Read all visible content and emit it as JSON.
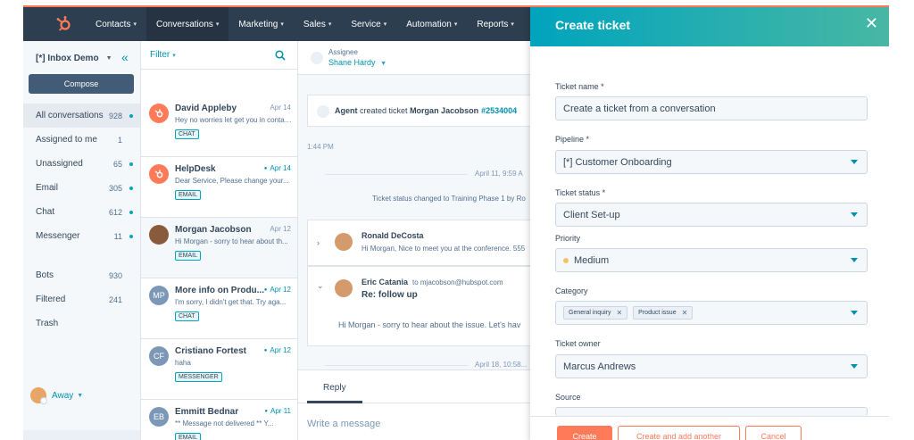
{
  "nav": {
    "items": [
      {
        "label": "Contacts"
      },
      {
        "label": "Conversations"
      },
      {
        "label": "Marketing"
      },
      {
        "label": "Sales"
      },
      {
        "label": "Service"
      },
      {
        "label": "Automation"
      },
      {
        "label": "Reports"
      }
    ]
  },
  "sidebar": {
    "inbox_name": "[*] Inbox Demo",
    "compose_label": "Compose",
    "items": [
      {
        "label": "All conversations",
        "count": "928"
      },
      {
        "label": "Assigned to me",
        "count": "1"
      },
      {
        "label": "Unassigned",
        "count": "65"
      },
      {
        "label": "Email",
        "count": "305"
      },
      {
        "label": "Chat",
        "count": "612"
      },
      {
        "label": "Messenger",
        "count": "11"
      },
      {
        "label": "Bots",
        "count": "930"
      },
      {
        "label": "Filtered",
        "count": "241"
      },
      {
        "label": "Trash",
        "count": ""
      }
    ],
    "status": "Away"
  },
  "list": {
    "filter_label": "Filter",
    "conversations": [
      {
        "name": "David Appleby",
        "date": "Apr 14",
        "preview": "Hey no worries let get you in contact...",
        "tag": "CHAT",
        "avatar": "HS"
      },
      {
        "name": "HelpDesk",
        "date": "Apr 14",
        "preview": "Dear Service, Please change your...",
        "tag": "EMAIL",
        "avatar": "HS"
      },
      {
        "name": "Morgan Jacobson",
        "date": "Apr 12",
        "preview": "Hi Morgan - sorry to hear about th...",
        "tag": "EMAIL",
        "avatar": ""
      },
      {
        "name": "More info on Produ...",
        "date": "Apr 12",
        "preview": "I'm sorry, I didn't get that. Try aga...",
        "tag": "CHAT",
        "avatar": "MP"
      },
      {
        "name": "Cristiano Fortest",
        "date": "Apr 12",
        "preview": "haha",
        "tag": "MESSENGER",
        "avatar": "CF"
      },
      {
        "name": "Emmitt Bednar",
        "date": "Apr 11",
        "preview": "** Message not delivered ** Y...",
        "tag": "EMAIL",
        "avatar": "EB"
      }
    ]
  },
  "thread": {
    "assignee_label": "Assignee",
    "assignee_name": "Shane Hardy",
    "event_agent": "Agent",
    "event_text": "created ticket",
    "event_contact": "Morgan Jacobson",
    "event_ticket": "#2534004",
    "event_time": "1:44 PM",
    "date_sep_1": "April 11, 9:59 A",
    "status_change": "Ticket status changed to Training Phase 1 by Ro",
    "msg1_name": "Ronald DeCosta",
    "msg1_preview": "Hi Morgan, Nice to meet you at the conference. 555",
    "msg2_name": "Eric Catania",
    "msg2_to": "to mjacobson@hubspot.com",
    "msg2_subject": "Re: follow up",
    "msg2_body": "Hi Morgan - sorry to hear about the issue. Let's hav",
    "date_sep_2": "April 18, 10:58...",
    "reply_tab": "Reply",
    "message_placeholder": "Write a message"
  },
  "panel": {
    "title": "Create ticket",
    "ticket_name_label": "Ticket name *",
    "ticket_name_value": "Create a ticket from a conversation",
    "pipeline_label": "Pipeline *",
    "pipeline_value": "[*] Customer Onboarding",
    "status_label": "Ticket status *",
    "status_value": "Client Set-up",
    "priority_label": "Priority",
    "priority_value": "Medium",
    "category_label": "Category",
    "categories": [
      "General inquiry",
      "Product issue"
    ],
    "owner_label": "Ticket owner",
    "owner_value": "Marcus Andrews",
    "source_label": "Source",
    "create_label": "Create",
    "create_another_label": "Create and add another",
    "cancel_label": "Cancel"
  },
  "colors": {
    "nav_bg": "#2d3e50",
    "accent_teal": "#00a4bd",
    "accent_orange": "#ff7a59",
    "link": "#0091ae"
  }
}
